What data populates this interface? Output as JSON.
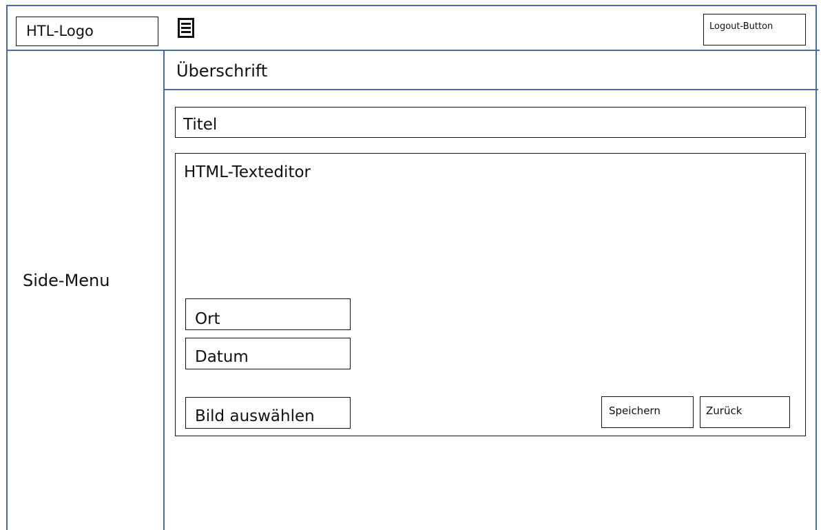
{
  "header": {
    "logo_text": "HTL-Logo",
    "menu_icon": "hamburger-menu-icon",
    "logout_label": "Logout-Button"
  },
  "sidebar": {
    "label": "Side-Menu"
  },
  "main": {
    "heading": "Überschrift",
    "title_field": "Titel",
    "editor_label": "HTML-Texteditor",
    "location_field": "Ort",
    "date_field": "Datum",
    "image_button": "Bild auswählen",
    "save_button": "Speichern",
    "back_button": "Zurück"
  },
  "colors": {
    "frame_lines": "#4a6aa8",
    "box_border": "#111111"
  }
}
